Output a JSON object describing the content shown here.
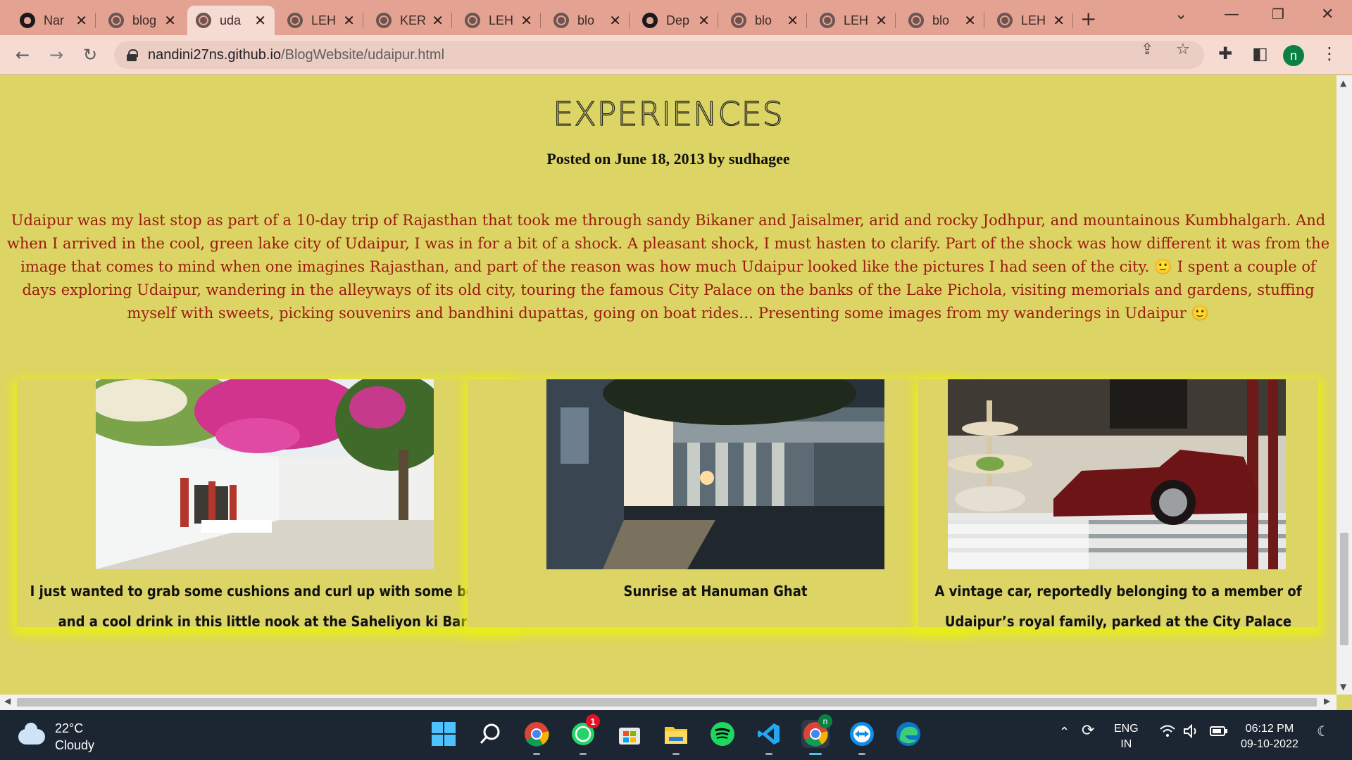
{
  "browser": {
    "tabs": [
      {
        "label": "Nar",
        "icon": "github-icon"
      },
      {
        "label": "blog",
        "icon": "globe-icon"
      },
      {
        "label": "uda",
        "icon": "globe-icon",
        "active": true
      },
      {
        "label": "LEH",
        "icon": "globe-icon"
      },
      {
        "label": "KER",
        "icon": "globe-icon"
      },
      {
        "label": "LEH",
        "icon": "globe-icon"
      },
      {
        "label": "blo",
        "icon": "globe-icon"
      },
      {
        "label": "Dep",
        "icon": "github-icon"
      },
      {
        "label": "blo",
        "icon": "globe-icon"
      },
      {
        "label": "LEH",
        "icon": "globe-icon"
      },
      {
        "label": "blo",
        "icon": "globe-icon"
      },
      {
        "label": "LEH",
        "icon": "globe-icon"
      }
    ],
    "url_host": "nandini27ns.github.io",
    "url_path": "/BlogWebsite/udaipur.html",
    "profile_initial": "n"
  },
  "post": {
    "title": "EXPERIENCES",
    "byline": "Posted on June 18, 2013 by sudhagee",
    "intro": "Udaipur was my last stop as part of a 10-day trip of Rajasthan that took me through sandy Bikaner and Jaisalmer, arid and rocky Jodhpur, and mountainous Kumbhalgarh. And when I arrived in the cool, green lake city of Udaipur, I was in for a bit of a shock. A pleasant shock, I must hasten to clarify. Part of the shock was how different it was from the image that comes to mind when one imagines Rajasthan, and part of the reason was how much Udaipur looked like the pictures I had seen of the city. 🙂 I spent a couple of days exploring Udaipur, wandering in the alleyways of its old city, touring the famous City Palace on the banks of the Lake Pichola, visiting memorials and gardens, stuffing myself with sweets, picking souvenirs and bandhini dupattas, going on boat rides… Presenting some images from my wanderings in Udaipur 🙂",
    "cards": [
      {
        "caption": "I just wanted to grab some cushions and curl up with some books and a cool drink in this little nook at the Saheliyon ki Bari"
      },
      {
        "caption": "Sunrise at Hanuman Ghat"
      },
      {
        "caption": "A vintage car, reportedly belonging to a member of Udaipur’s royal family, parked at the City Palace"
      }
    ]
  },
  "taskbar": {
    "temperature": "22°C",
    "condition": "Cloudy",
    "whatsapp_badge": "1",
    "profile_badge": "n",
    "lang": "ENG",
    "region": "IN",
    "time": "06:12 PM",
    "date": "09-10-2022"
  }
}
